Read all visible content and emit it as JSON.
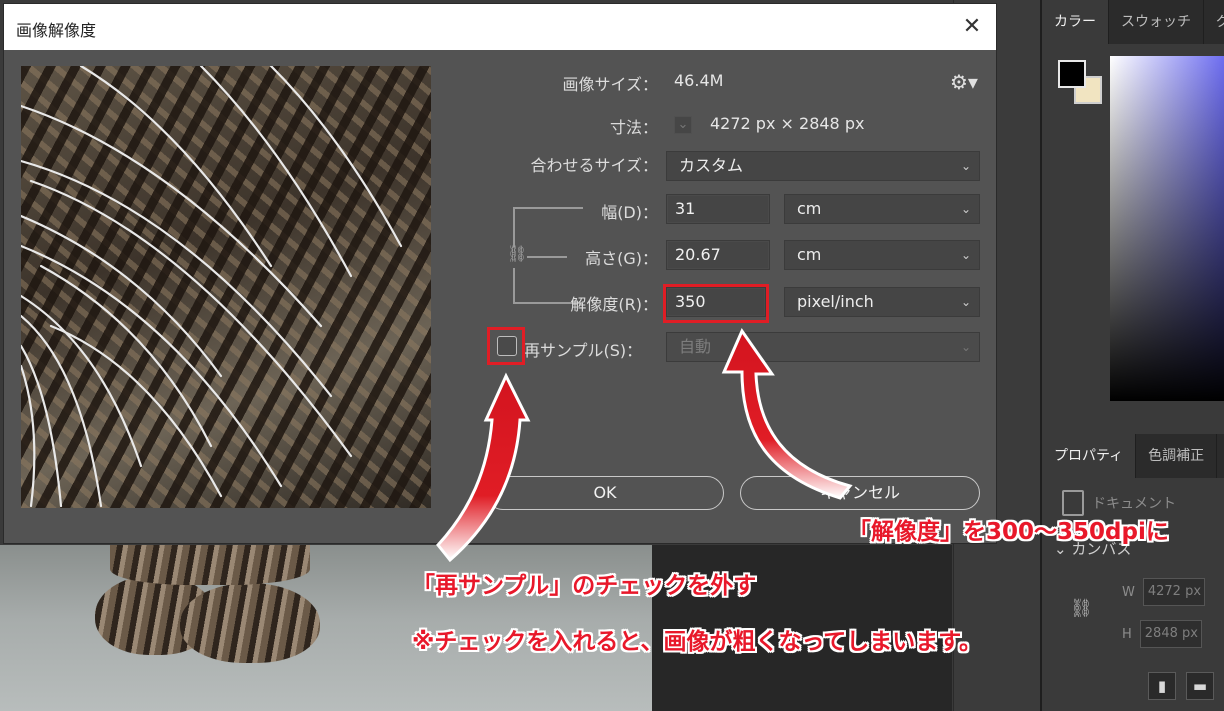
{
  "dialog": {
    "title": "画像解像度",
    "image_size_label": "画像サイズ：",
    "image_size_value": "46.4M",
    "dimensions_label": "寸法：",
    "dimensions_value": "4272 px × 2848 px",
    "fit_to_label": "合わせるサイズ：",
    "fit_to_value": "カスタム",
    "width_label": "幅(D)：",
    "width_value": "31",
    "width_unit": "cm",
    "height_label": "高さ(G)：",
    "height_value": "20.67",
    "height_unit": "cm",
    "resolution_label": "解像度(R)：",
    "resolution_value": "350",
    "resolution_unit": "pixel/inch",
    "resample_label": "再サンプル(S)：",
    "resample_checked": false,
    "resample_method": "自動",
    "ok_label": "OK",
    "cancel_label": "キャンセル"
  },
  "right_panel": {
    "top_tabs": [
      "カラー",
      "スウォッチ",
      "グラ"
    ],
    "lower_tabs": [
      "プロパティ",
      "色調補正"
    ],
    "document_label": "ドキュメント",
    "canvas_section": "カンバス",
    "w_label": "W",
    "w_value": "4272 px",
    "h_label": "H",
    "h_value": "2848 px",
    "foreground_color": "#000000",
    "background_color": "#f1e4c1"
  },
  "annotations": {
    "resolution_note": "「解像度」を300～350dpiに",
    "resample_note": "「再サンプル」のチェックを外す",
    "warning_note": "※チェックを入れると、画像が粗くなってしまいます。",
    "accent_color": "#e01d25"
  },
  "icons": {
    "close": "close-icon",
    "gear": "gear-icon",
    "link": "link-icon",
    "dropdown": "chevron-down-icon"
  }
}
